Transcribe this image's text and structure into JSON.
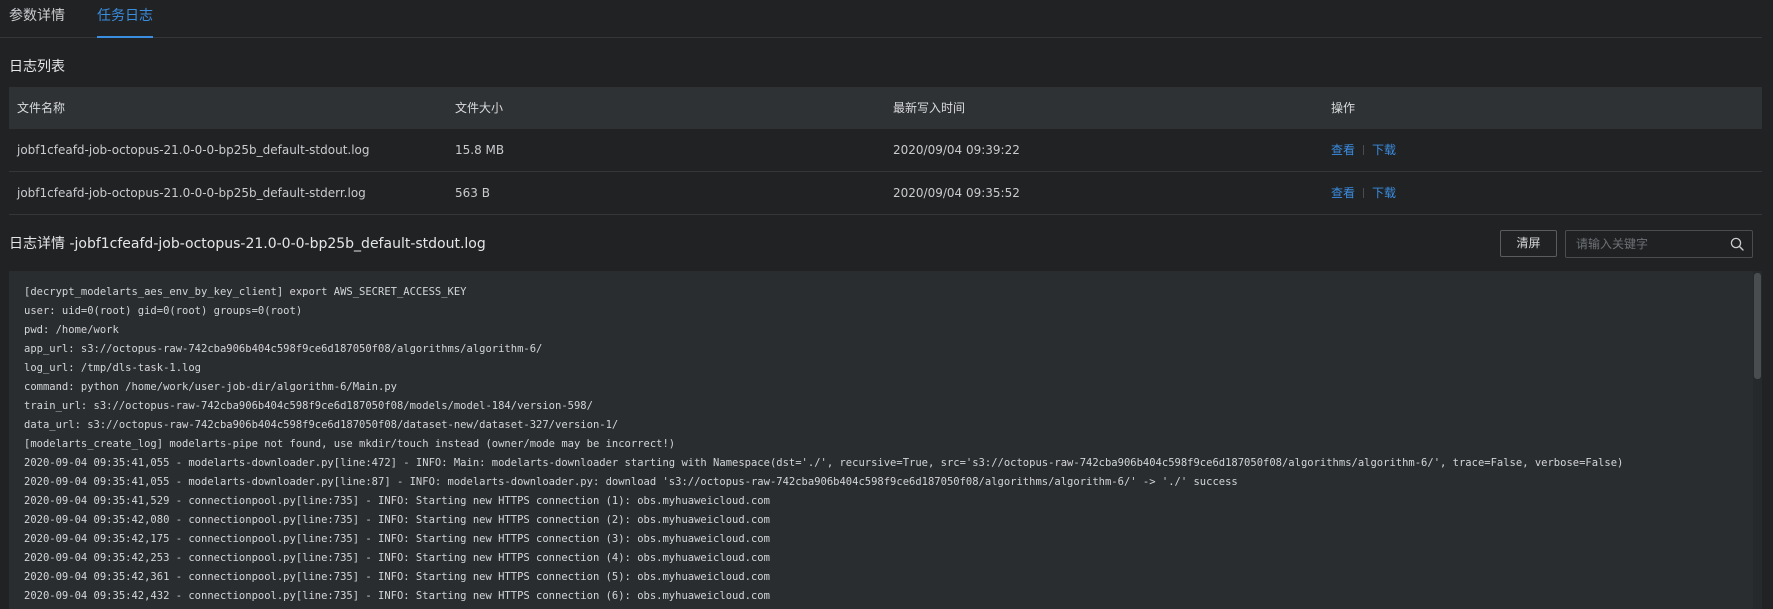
{
  "tabs": [
    {
      "label": "参数详情",
      "active": false
    },
    {
      "label": "任务日志",
      "active": true
    }
  ],
  "colors": {
    "accent": "#3b8de0",
    "background": "#202224",
    "panel": "#2a2d30",
    "table_header": "#2f3234"
  },
  "log_list": {
    "title": "日志列表",
    "columns": [
      "文件名称",
      "文件大小",
      "最新写入时间",
      "操作"
    ],
    "rows": [
      {
        "name": "jobf1cfeafd-job-octopus-21.0-0-0-bp25b_default-stdout.log",
        "size": "15.8 MB",
        "time": "2020/09/04 09:39:22",
        "view": "查看",
        "download": "下载"
      },
      {
        "name": "jobf1cfeafd-job-octopus-21.0-0-0-bp25b_default-stderr.log",
        "size": "563 B",
        "time": "2020/09/04 09:35:52",
        "view": "查看",
        "download": "下载"
      }
    ]
  },
  "log_detail": {
    "title": "日志详情 -jobf1cfeafd-job-octopus-21.0-0-0-bp25b_default-stdout.log",
    "clear_label": "清屏",
    "search_placeholder": "请输入关键字",
    "search_icon": "search-icon",
    "lines": [
      "[decrypt_modelarts_aes_env_by_key_client] export AWS_SECRET_ACCESS_KEY",
      "user: uid=0(root) gid=0(root) groups=0(root)",
      "pwd: /home/work",
      "app_url: s3://octopus-raw-742cba906b404c598f9ce6d187050f08/algorithms/algorithm-6/",
      "log_url: /tmp/dls-task-1.log",
      "command: python /home/work/user-job-dir/algorithm-6/Main.py",
      "train_url: s3://octopus-raw-742cba906b404c598f9ce6d187050f08/models/model-184/version-598/",
      "data_url: s3://octopus-raw-742cba906b404c598f9ce6d187050f08/dataset-new/dataset-327/version-1/",
      "[modelarts_create_log] modelarts-pipe not found, use mkdir/touch instead (owner/mode may be incorrect!)",
      "2020-09-04 09:35:41,055 - modelarts-downloader.py[line:472] - INFO: Main: modelarts-downloader starting with Namespace(dst='./', recursive=True, src='s3://octopus-raw-742cba906b404c598f9ce6d187050f08/algorithms/algorithm-6/', trace=False, verbose=False)",
      "2020-09-04 09:35:41,055 - modelarts-downloader.py[line:87] - INFO: modelarts-downloader.py: download 's3://octopus-raw-742cba906b404c598f9ce6d187050f08/algorithms/algorithm-6/' -> './' success",
      "2020-09-04 09:35:41,529 - connectionpool.py[line:735] - INFO: Starting new HTTPS connection (1): obs.myhuaweicloud.com",
      "2020-09-04 09:35:42,080 - connectionpool.py[line:735] - INFO: Starting new HTTPS connection (2): obs.myhuaweicloud.com",
      "2020-09-04 09:35:42,175 - connectionpool.py[line:735] - INFO: Starting new HTTPS connection (3): obs.myhuaweicloud.com",
      "2020-09-04 09:35:42,253 - connectionpool.py[line:735] - INFO: Starting new HTTPS connection (4): obs.myhuaweicloud.com",
      "2020-09-04 09:35:42,361 - connectionpool.py[line:735] - INFO: Starting new HTTPS connection (5): obs.myhuaweicloud.com",
      "2020-09-04 09:35:42,432 - connectionpool.py[line:735] - INFO: Starting new HTTPS connection (6): obs.myhuaweicloud.com"
    ]
  }
}
